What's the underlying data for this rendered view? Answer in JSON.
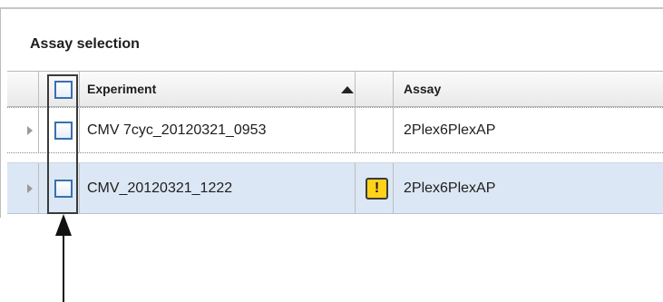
{
  "panel": {
    "title": "Assay selection"
  },
  "table": {
    "columns": {
      "experiment": "Experiment",
      "assay": "Assay"
    },
    "sort": {
      "column": "Experiment",
      "direction": "ascending",
      "icon": "sort-ascending-icon"
    },
    "rows": [
      {
        "experiment": "CMV 7cyc_20120321_0953",
        "assay": "2Plex6PlexAP",
        "warning": false,
        "checked": false,
        "selected": false
      },
      {
        "experiment": "CMV_20120321_1222",
        "assay": "2Plex6PlexAP",
        "warning": true,
        "warning_symbol": "!",
        "checked": false,
        "selected": true
      }
    ]
  },
  "colors": {
    "checkbox_border": "#3a6fb0",
    "selected_row": "#dce7f5",
    "warning": "#ffd21a"
  },
  "icons": {
    "expander": "triangle-right-icon",
    "warning": "warning-icon",
    "annotation": "arrow-up-icon"
  }
}
